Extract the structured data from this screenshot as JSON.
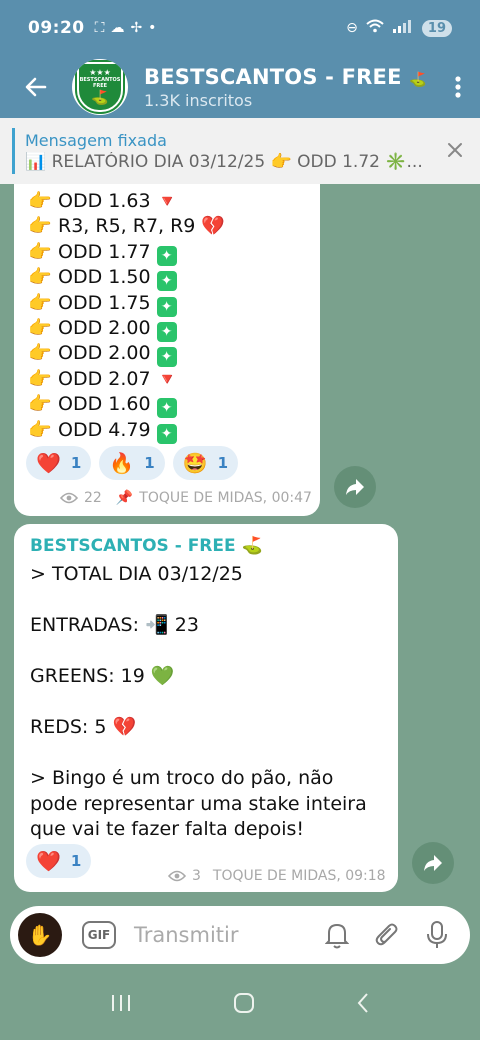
{
  "status": {
    "time": "09:20",
    "battery": "19"
  },
  "header": {
    "title": "BESTSCANTOS - FREE",
    "title_badge": "⛳",
    "subtitle": "1.3K inscritos",
    "avatar_stars": "★★★",
    "avatar_text": "BESTSCANTOS FREE"
  },
  "pinned": {
    "label": "Mensagem fixada",
    "text": "📊 RELATÓRIO DIA 03/12/25  👉 ODD 1.72 ✳️..."
  },
  "message1": {
    "rows": [
      {
        "text": "ODD 1.63",
        "result": "red"
      },
      {
        "text": "R3, R5, R7, R9 💔",
        "result": "none"
      },
      {
        "text": "ODD 1.77",
        "result": "green"
      },
      {
        "text": "ODD 1.50",
        "result": "green"
      },
      {
        "text": "ODD 1.75",
        "result": "green"
      },
      {
        "text": "ODD 2.00",
        "result": "green"
      },
      {
        "text": "ODD 2.00",
        "result": "green"
      },
      {
        "text": "ODD 2.07",
        "result": "red"
      },
      {
        "text": "ODD 1.60",
        "result": "green"
      },
      {
        "text": "ODD 4.79",
        "result": "green"
      }
    ],
    "reactions": [
      {
        "icon": "❤️",
        "count": "1"
      },
      {
        "icon": "🔥",
        "count": "1"
      },
      {
        "icon": "🤩",
        "count": "1"
      }
    ],
    "views": "22",
    "author_time": "TOQUE DE MIDAS, 00:47"
  },
  "message2": {
    "sender": "BESTSCANTOS - FREE ⛳",
    "body": "> TOTAL DIA 03/12/25\n\nENTRADAS: 📲 23\n\nGREENS: 19 💚\n\nREDS: 5 💔\n\n> Bingo é um troco do pão, não pode representar uma stake inteira que vai te fazer falta depois!",
    "reactions": [
      {
        "icon": "❤️",
        "count": "1"
      }
    ],
    "views": "3",
    "author_time": "TOQUE DE MIDAS, 09:18"
  },
  "input": {
    "placeholder": "Transmitir",
    "gif_label": "GIF"
  },
  "icons": {
    "back": "arrow-left-icon",
    "menu": "more-vertical-icon",
    "close": "close-icon",
    "share": "share-icon",
    "bell": "bell-icon",
    "attach": "paperclip-icon",
    "mic": "microphone-icon"
  }
}
